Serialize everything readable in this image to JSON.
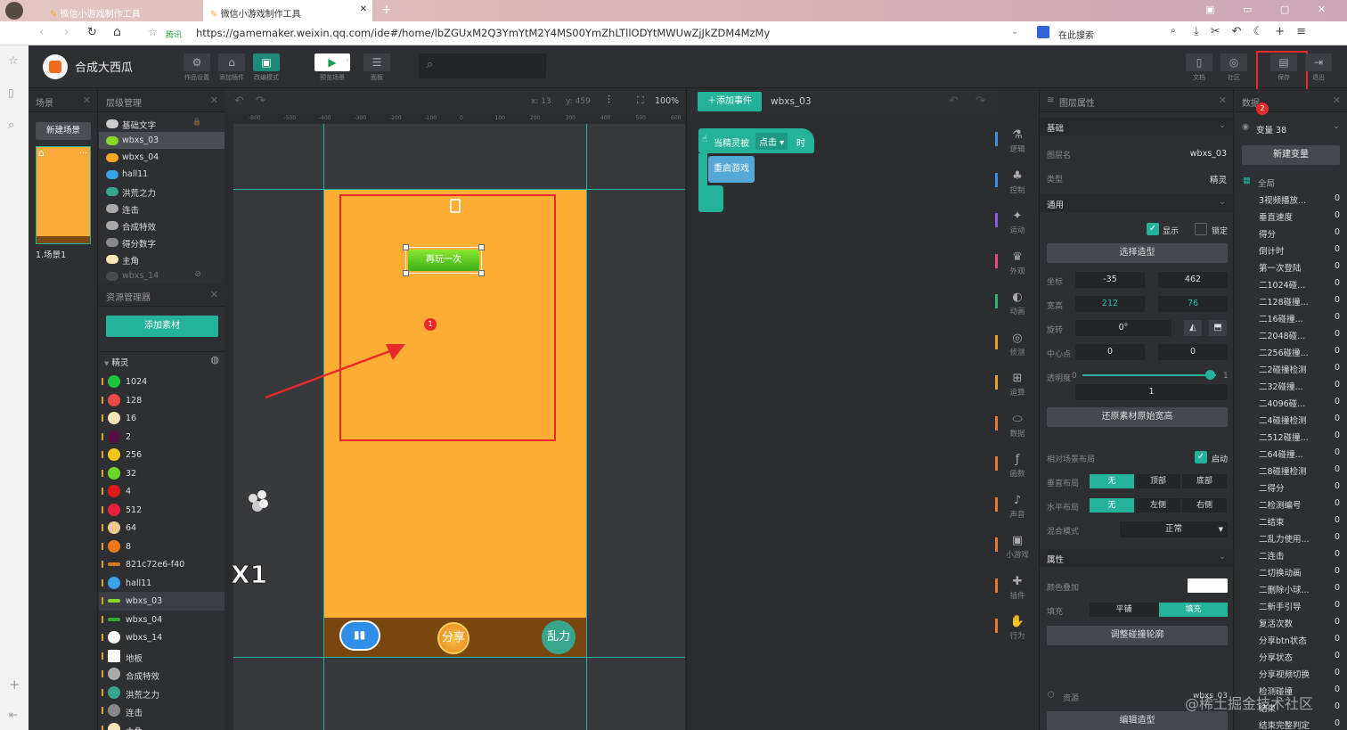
{
  "browser": {
    "tabs": [
      "微信小游戏制作工具",
      "微信小游戏制作工具"
    ],
    "security_label": "腾讯",
    "url": "https://gamemaker.weixin.qq.com/ide#/home/lbZGUxM2Q3YmYtM2Y4MS00YmZhLTllODYtMWUwZjJkZDM4MzMy",
    "search_placeholder": "在此搜索"
  },
  "app": {
    "project_name": "合成大西瓜",
    "toolbar": [
      "作品设置",
      "添加插件",
      "改编模式",
      "预览场景",
      "面板"
    ],
    "right_toolbar": [
      "文档",
      "社区",
      "保存",
      "退出"
    ]
  },
  "scene_panel": {
    "title": "场景",
    "new_scene": "新建场景",
    "scene_label": "1.场景1"
  },
  "layer_panel": {
    "title": "层级管理",
    "items": [
      "基础文字",
      "wbxs_03",
      "wbxs_04",
      "hall11",
      "洪荒之力",
      "连击",
      "合成特效",
      "得分数字",
      "主角",
      "wbxs_14"
    ]
  },
  "asset_panel": {
    "title": "资源管理器",
    "add_asset": "添加素材",
    "group": "精灵",
    "sprites": [
      "1024",
      "128",
      "16",
      "2",
      "256",
      "32",
      "4",
      "512",
      "64",
      "8",
      "821c72e6-f40",
      "hall11",
      "wbxs_03",
      "wbxs_04",
      "wbxs_14",
      "地板",
      "合成特效",
      "洪荒之力",
      "连击",
      "主角"
    ],
    "sprite_colors": [
      "#22c43a",
      "#f04848",
      "#f5e6b8",
      "#5a1040",
      "#f5c518",
      "#6fd62a",
      "#e01818",
      "#e8203c",
      "#f0c890",
      "#f07818",
      "#d07a20",
      "#3aa0e8",
      "#8bd628",
      "#34a835",
      "#ffffff",
      "#ffffff",
      "#aaaaaa",
      "#3aa58e",
      "#888888",
      "#f5e6b8"
    ]
  },
  "canvas": {
    "coord_x": "x: 13",
    "coord_y": "y: 459",
    "zoom": "100%",
    "ruler_ticks": [
      "-600",
      "-500",
      "-400",
      "-300",
      "-200",
      "-100",
      "0",
      "100",
      "200",
      "300",
      "400",
      "500",
      "600"
    ],
    "play_again": "再玩一次",
    "share": "分享",
    "power": "乱力",
    "combo": "X1",
    "annotation_1": "1"
  },
  "event_panel": {
    "add_event": "添加事件",
    "sprite_name": "wbxs_03",
    "block_when": "当精灵被",
    "block_action": "点击",
    "block_suffix": "时",
    "block_restart": "重启游戏"
  },
  "categories": [
    {
      "label": "逻辑",
      "color": "#3a8ee8"
    },
    {
      "label": "控制",
      "color": "#3a8ee8"
    },
    {
      "label": "运动",
      "color": "#8a5ce8"
    },
    {
      "label": "外观",
      "color": "#e84a7a"
    },
    {
      "label": "动画",
      "color": "#2ab868"
    },
    {
      "label": "侦测",
      "color": "#e8a030"
    },
    {
      "label": "运算",
      "color": "#e8a030"
    },
    {
      "label": "数据",
      "color": "#e87a30"
    },
    {
      "label": "函数",
      "color": "#e87a30"
    },
    {
      "label": "声音",
      "color": "#e87a30"
    },
    {
      "label": "小游戏",
      "color": "#e87a30"
    },
    {
      "label": "插件",
      "color": "#e87a30"
    },
    {
      "label": "行为",
      "color": "#e87a30"
    }
  ],
  "props": {
    "title": "图层属性",
    "basic": "基础",
    "layer_name_label": "图层名",
    "layer_name": "wbxs_03",
    "type_label": "类型",
    "type": "精灵",
    "general": "通用",
    "show": "显示",
    "lock": "锁定",
    "choose_shape": "选择造型",
    "pos_label": "坐标",
    "x": "-35",
    "y": "462",
    "size_label": "宽高",
    "w": "212",
    "h": "76",
    "rotate_label": "旋转",
    "rotate": "0°",
    "center_label": "中心点",
    "cx": "0",
    "cy": "0",
    "opacity_label": "透明度",
    "opacity_min": "0",
    "opacity_max": "1",
    "opacity": "1",
    "opacity_fill": 1,
    "restore": "还原素材原始宽高",
    "relative_layout": "相对场景布局",
    "enable": "启动",
    "v_layout": "垂直布局",
    "v_opts": [
      "无",
      "顶部",
      "底部"
    ],
    "h_layout": "水平布局",
    "h_opts": [
      "无",
      "左侧",
      "右侧"
    ],
    "blend_label": "混合模式",
    "blend": "正常",
    "attrs": "属性",
    "color_add": "颜色叠加",
    "fill_label": "填充",
    "fill_opts": [
      "平铺",
      "填充"
    ],
    "collision": "调整碰撞轮廓",
    "resource": "资源",
    "resource_name": "wbxs_03",
    "edit_shape": "编辑造型"
  },
  "data_panel": {
    "title": "数据",
    "var_count": "变量 38",
    "new_var": "新建变量",
    "global": "全局",
    "vars": [
      {
        "name": "3视频播放...",
        "value": "0"
      },
      {
        "name": "垂直速度",
        "value": "0"
      },
      {
        "name": "得分",
        "value": "0"
      },
      {
        "name": "倒计时",
        "value": "0"
      },
      {
        "name": "第一次登陆",
        "value": "0"
      },
      {
        "name": "二1024碰...",
        "value": "0"
      },
      {
        "name": "二128碰撞...",
        "value": "0"
      },
      {
        "name": "二16碰撞...",
        "value": "0"
      },
      {
        "name": "二2048碰...",
        "value": "0"
      },
      {
        "name": "二256碰撞...",
        "value": "0"
      },
      {
        "name": "二2碰撞检测",
        "value": "0"
      },
      {
        "name": "二32碰撞...",
        "value": "0"
      },
      {
        "name": "二4096碰...",
        "value": "0"
      },
      {
        "name": "二4碰撞检测",
        "value": "0"
      },
      {
        "name": "二512碰撞...",
        "value": "0"
      },
      {
        "name": "二64碰撞...",
        "value": "0"
      },
      {
        "name": "二8碰撞检测",
        "value": "0"
      },
      {
        "name": "二得分",
        "value": "0"
      },
      {
        "name": "二检测编号",
        "value": "0"
      },
      {
        "name": "二结束",
        "value": "0"
      },
      {
        "name": "二乱力使用...",
        "value": "0"
      },
      {
        "name": "二连击",
        "value": "0"
      },
      {
        "name": "二切换动画",
        "value": "0"
      },
      {
        "name": "二删除小球...",
        "value": "0"
      },
      {
        "name": "二新手引导",
        "value": "0"
      },
      {
        "name": "复活次数",
        "value": "0"
      },
      {
        "name": "分享btn状态",
        "value": "0"
      },
      {
        "name": "分享状态",
        "value": "0"
      },
      {
        "name": "分享视频切换",
        "value": "0"
      },
      {
        "name": "检测碰撞",
        "value": "0"
      },
      {
        "name": "结束",
        "value": "0"
      },
      {
        "name": "结束完整判定",
        "value": "0"
      }
    ],
    "annotation_2": "2"
  },
  "watermark": "@稀土掘金技术社区"
}
